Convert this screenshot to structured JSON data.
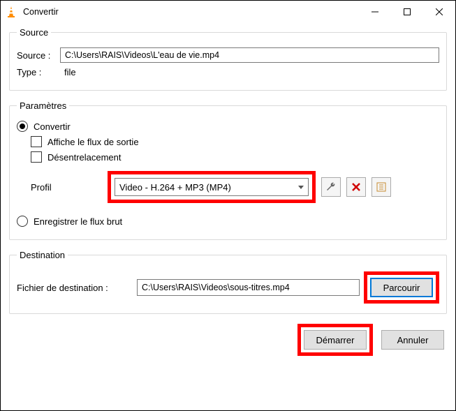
{
  "window": {
    "title": "Convertir"
  },
  "source": {
    "legend": "Source",
    "source_label": "Source :",
    "source_value": "C:\\Users\\RAIS\\Videos\\L'eau de vie.mp4",
    "type_label": "Type :",
    "type_value": "file"
  },
  "params": {
    "legend": "Paramètres",
    "convert_label": "Convertir",
    "show_stream_label": "Affiche le flux de sortie",
    "deinterlace_label": "Désentrelacement",
    "profile_label": "Profil",
    "profile_value": "Video - H.264 + MP3 (MP4)",
    "raw_label": "Enregistrer le flux brut"
  },
  "dest": {
    "legend": "Destination",
    "file_label": "Fichier de destination :",
    "file_value": "C:\\Users\\RAIS\\Videos\\sous-titres.mp4",
    "browse_label": "Parcourir"
  },
  "footer": {
    "start_label": "Démarrer",
    "cancel_label": "Annuler"
  },
  "icons": {
    "wrench": "wrench-icon",
    "delete": "delete-icon",
    "new_profile": "new-profile-icon"
  }
}
